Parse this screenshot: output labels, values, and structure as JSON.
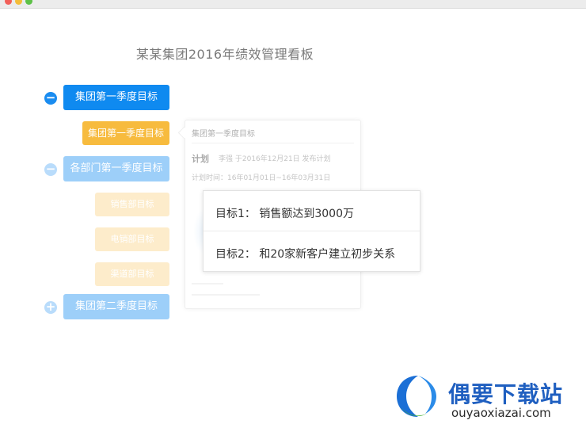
{
  "window": {
    "controls": [
      "close-icon",
      "minimize-icon",
      "maximize-icon"
    ]
  },
  "page": {
    "title": "某某集团2016年绩效管理看板"
  },
  "tree": {
    "toggle_icons": [
      "minus-circle-icon",
      "minus-circle-icon",
      "plus-circle-icon"
    ],
    "nodes": [
      {
        "label": "集团第一季度目标",
        "state": "expanded",
        "color": "#0f8af0"
      },
      {
        "label": "集团第一季度目标",
        "state": "selected",
        "color": "#f7bb3e"
      },
      {
        "label": "各部门第一季度目标",
        "state": "expanded",
        "color": "#9dcff9"
      },
      {
        "label": "销售部目标",
        "color": "#fdeccb"
      },
      {
        "label": "电销部目标",
        "color": "#fdeccb"
      },
      {
        "label": "渠道部目标",
        "color": "#fdeccb"
      },
      {
        "label": "集团第二季度目标",
        "state": "collapsed",
        "color": "#9dcff9"
      }
    ]
  },
  "detail_card": {
    "header": "集团第一季度目标",
    "plan_label": "计划",
    "plan_meta": "李强 于2016年12月21日 发布计划",
    "time_range": "计划时间：16年01月01日~16年03月31日"
  },
  "popup": {
    "goals": [
      "目标1： 销售额达到3000万",
      "目标2： 和20家新客户建立初步关系"
    ]
  },
  "watermark": {
    "name": "偶要下载站",
    "url": "ouyaoxiazai.com",
    "logo_icon": "ouyao-logo-icon",
    "brand_color": "#1f5fc0"
  }
}
